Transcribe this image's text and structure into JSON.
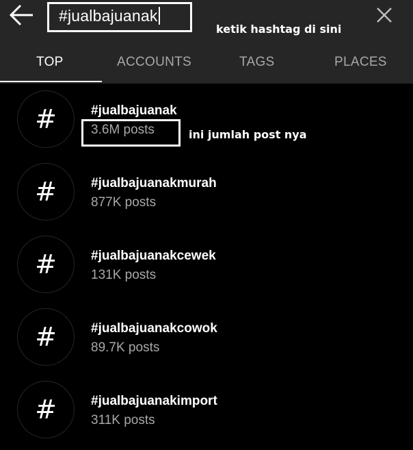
{
  "search": {
    "query": "#jualbajuanak"
  },
  "annotations": {
    "search_hint": "ketik hashtag di sini",
    "count_hint": "ini jumlah post nya"
  },
  "tabs": [
    {
      "label": "TOP",
      "active": true
    },
    {
      "label": "ACCOUNTS",
      "active": false
    },
    {
      "label": "TAGS",
      "active": false
    },
    {
      "label": "PLACES",
      "active": false
    }
  ],
  "results": [
    {
      "icon": "hashtag-icon",
      "name": "#jualbajuanak",
      "count": "3.6M posts"
    },
    {
      "icon": "hashtag-icon",
      "name": "#jualbajuanakmurah",
      "count": "877K posts"
    },
    {
      "icon": "hashtag-icon",
      "name": "#jualbajuanakcewek",
      "count": "131K posts"
    },
    {
      "icon": "hashtag-icon",
      "name": "#jualbajuanakcowok",
      "count": "89.7K posts"
    },
    {
      "icon": "hashtag-icon",
      "name": "#jualbajuanakimport",
      "count": "311K posts"
    }
  ],
  "colors": {
    "background": "#000000",
    "header": "#262626",
    "secondary_text": "#a8a8a8",
    "primary_text": "#ffffff"
  }
}
